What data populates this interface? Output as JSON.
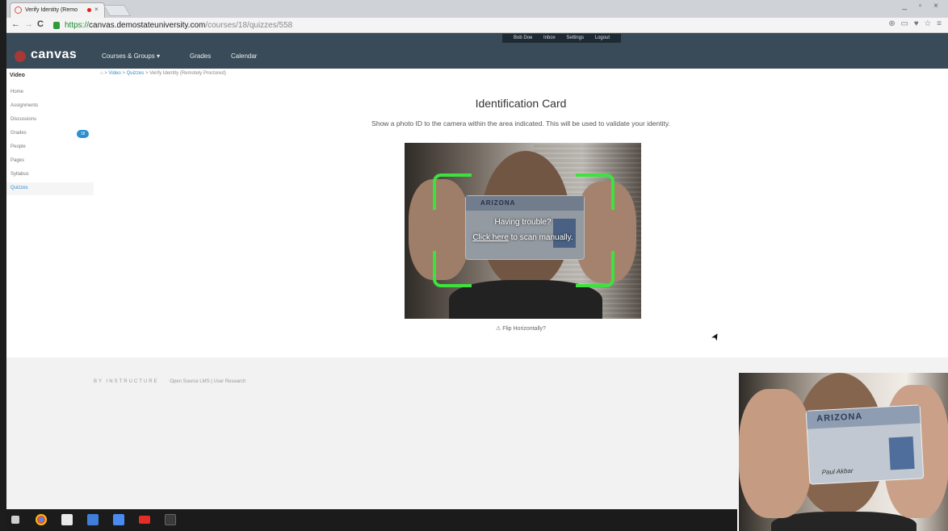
{
  "browser": {
    "tab_title": "Verify Identity (Remo",
    "tab_close": "×",
    "url_scheme": "https://",
    "url_host": "canvas.demostateuniversity.com",
    "url_path": "/courses/18/quizzes/558",
    "window_controls": "_ ▫ ×",
    "back_icon": "←",
    "forward_icon": "→",
    "reload_icon": "C",
    "toolbar_icons": "⊕ ▭ ♥ ☆ ≡"
  },
  "header": {
    "logo": "canvas",
    "nav": [
      "Courses & Groups ▾",
      "Grades",
      "Calendar"
    ],
    "user_menu": [
      "Bob Doe",
      "Inbox",
      "Settings",
      "Logout"
    ]
  },
  "sidebar": {
    "course": "Video",
    "items": [
      {
        "label": "Home"
      },
      {
        "label": "Assignments"
      },
      {
        "label": "Discussions"
      },
      {
        "label": "Grades"
      },
      {
        "label": "People"
      },
      {
        "label": "Pages"
      },
      {
        "label": "Syllabus"
      },
      {
        "label": "Quizzes"
      }
    ],
    "grades_badge": "18",
    "active": "Quizzes"
  },
  "breadcrumb": {
    "home_icon": "⌂",
    "sep": ">",
    "items": [
      "Video",
      "Quizzes",
      "Verify Identity (Remotely Proctored)"
    ]
  },
  "main": {
    "title": "Identification Card",
    "instructions": "Show a photo ID to the camera within the area indicated. This will be used to validate your identity.",
    "trouble_text": "Having trouble?",
    "click_here": "Click here",
    "scan_rest": " to scan manually.",
    "flip_link": "Flip Horizontally?",
    "flip_icon": "⚠",
    "card_state": "ARIZONA",
    "cursor_icon": "➤"
  },
  "footer": {
    "brand": "BY INSTRUCTURE",
    "links": "Open Source LMS | User Research"
  },
  "webcam": {
    "card_state": "ARIZONA",
    "signature": "Paul Akbar"
  },
  "colors": {
    "header_bg": "#394b58",
    "accent": "#2b8fd0",
    "frame_green": "#3ee23e"
  }
}
